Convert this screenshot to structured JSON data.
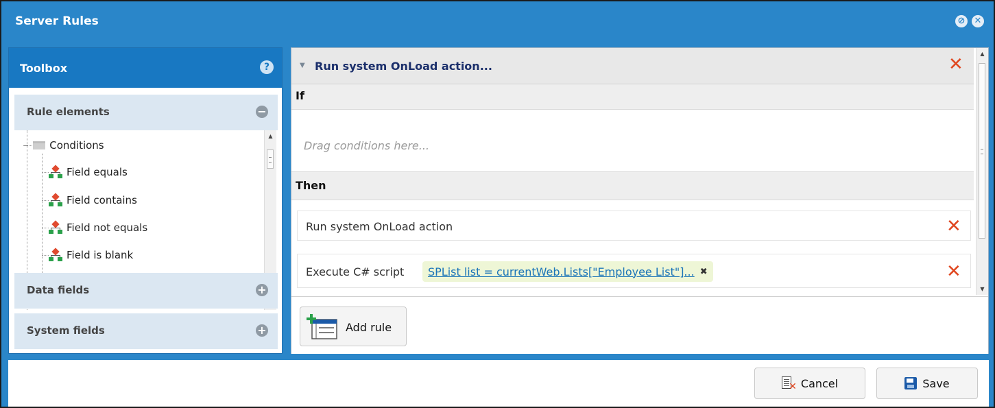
{
  "window": {
    "title": "Server Rules"
  },
  "toolbox": {
    "title": "Toolbox",
    "sections": [
      {
        "label": "Rule elements",
        "state": "expanded"
      },
      {
        "label": "Data fields",
        "state": "collapsed"
      },
      {
        "label": "System fields",
        "state": "collapsed"
      }
    ],
    "tree": {
      "folder": "Conditions",
      "items": [
        "Field equals",
        "Field contains",
        "Field not equals",
        "Field is blank"
      ]
    }
  },
  "rule": {
    "title": "Run system OnLoad action...",
    "if_label": "If",
    "drag_placeholder": "Drag conditions here...",
    "then_label": "Then",
    "actions": [
      {
        "label": "Run system OnLoad action"
      },
      {
        "label": "Execute C# script",
        "chip": "SPList list = currentWeb.Lists[\"Employee List\"]..."
      }
    ],
    "add_rule_label": "Add rule"
  },
  "footer": {
    "cancel_label": "Cancel",
    "save_label": "Save"
  },
  "colors": {
    "title_bar": "#2a86c9",
    "toolbox_header": "#1878c2",
    "delete_x": "#e0461f",
    "chip_bg": "#eef6d6"
  }
}
